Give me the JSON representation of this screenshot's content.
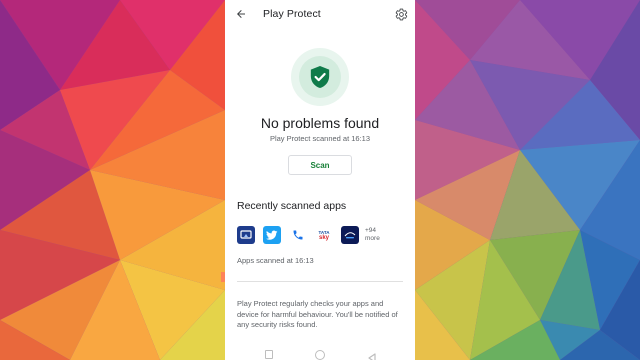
{
  "appbar": {
    "title": "Play Protect",
    "back_icon": "arrow-left-icon",
    "settings_icon": "gear-icon"
  },
  "status": {
    "icon": "shield-check-icon",
    "title": "No problems found",
    "subtitle": "Play Protect scanned at 16:13",
    "scan_label": "Scan"
  },
  "recent": {
    "title": "Recently scanned apps",
    "apps": [
      {
        "name": "screencast-app-icon"
      },
      {
        "name": "twitter-app-icon"
      },
      {
        "name": "phone-app-icon"
      },
      {
        "name": "tata-sky-app-icon",
        "top": "TATA",
        "bottom": "sky"
      },
      {
        "name": "disney-hotstar-app-icon"
      }
    ],
    "more_count": "+94",
    "more_label": "more",
    "scanned_text": "Apps scanned at 16:13"
  },
  "info": {
    "text": "Play Protect regularly checks your apps and device for harmful behaviour. You'll be notified of any security risks found."
  },
  "colors": {
    "accent_green": "#188038",
    "shield_green": "#0f7b4a"
  }
}
